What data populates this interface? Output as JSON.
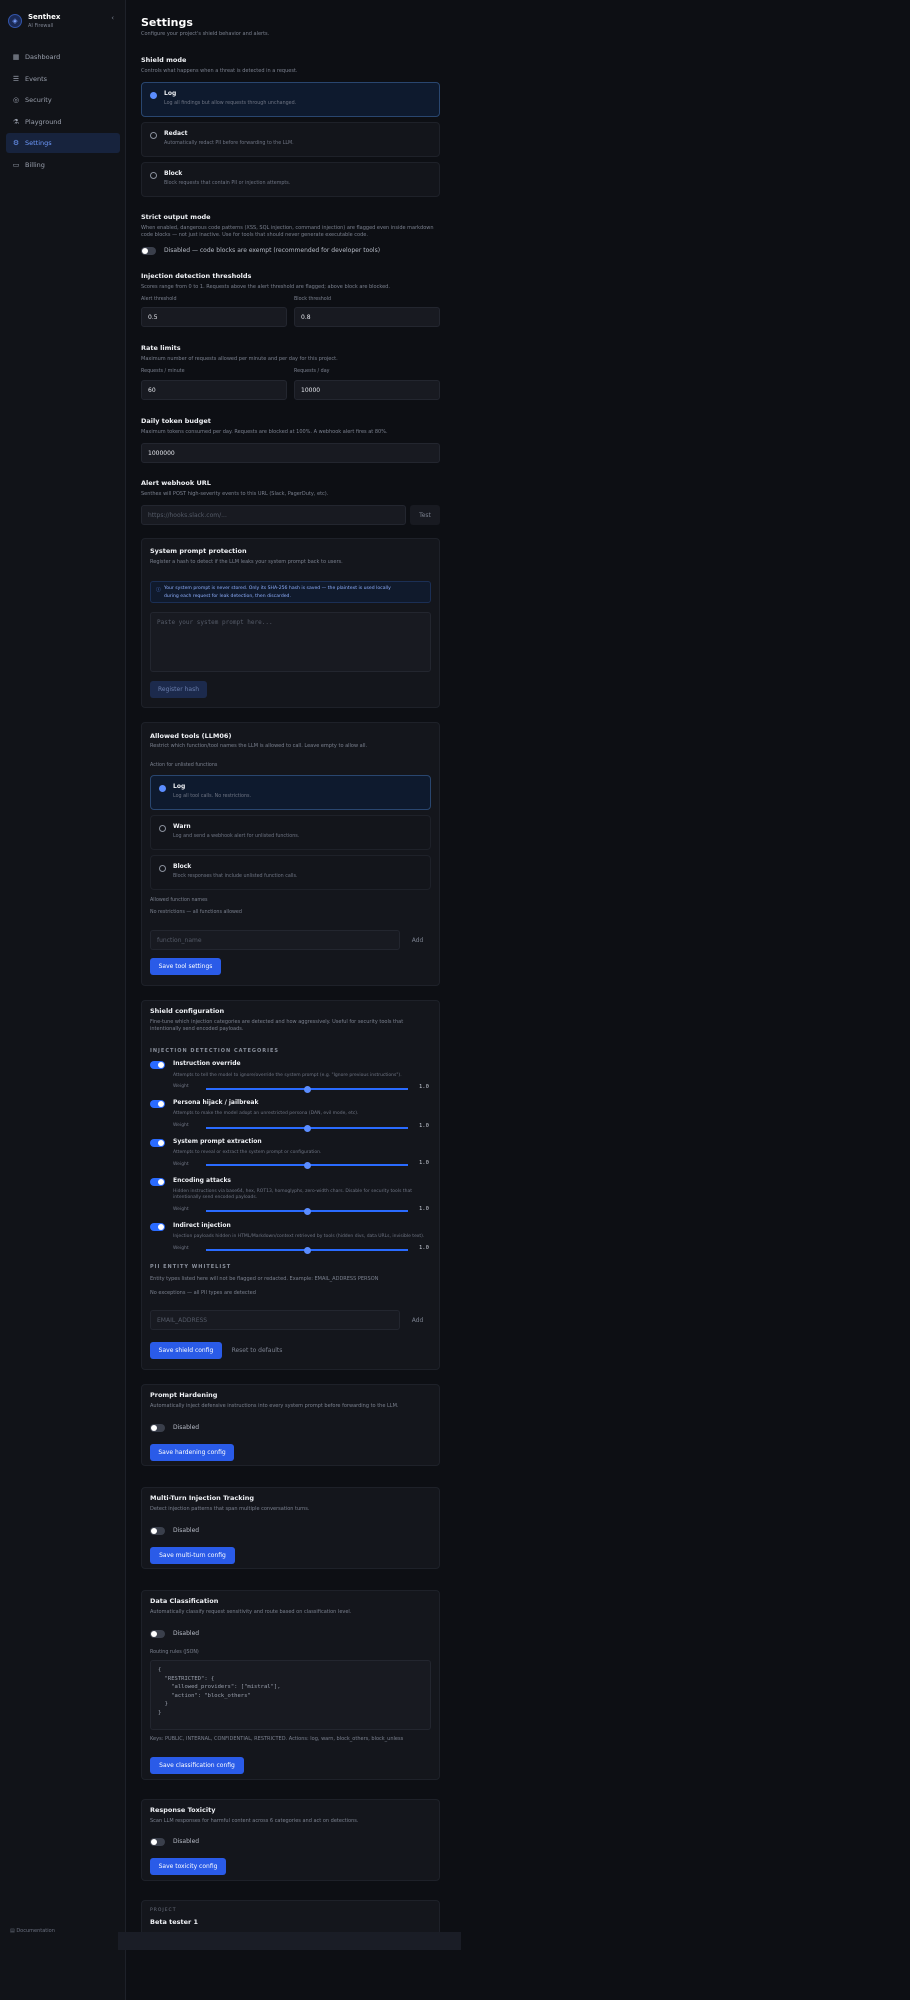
{
  "app": {
    "name": "Senthex",
    "subtitle": "AI Firewall",
    "collapse_icon": "chevron-left-icon"
  },
  "nav": [
    {
      "label": "Dashboard",
      "icon": "grid-icon",
      "active": false
    },
    {
      "label": "Events",
      "icon": "list-icon",
      "active": false
    },
    {
      "label": "Security",
      "icon": "shield-icon",
      "active": false
    },
    {
      "label": "Playground",
      "icon": "flask-icon",
      "active": false
    },
    {
      "label": "Settings",
      "icon": "gear-icon",
      "active": true
    },
    {
      "label": "Billing",
      "icon": "card-icon",
      "active": false
    }
  ],
  "footer": {
    "text": "Documentation"
  },
  "page": {
    "title": "Settings",
    "subtitle": "Configure your project's shield behavior and alerts."
  },
  "shield_mode": {
    "title": "Shield mode",
    "desc": "Controls what happens when a threat is detected in a request.",
    "options": [
      {
        "label": "Log",
        "desc": "Log all findings but allow requests through unchanged.",
        "selected": true
      },
      {
        "label": "Redact",
        "desc": "Automatically redact PII before forwarding to the LLM.",
        "selected": false
      },
      {
        "label": "Block",
        "desc": "Block requests that contain PII or injection attempts.",
        "selected": false
      }
    ]
  },
  "strict": {
    "title": "Strict output mode",
    "desc1": "When enabled, dangerous code patterns (XSS, SQL injection, command injection) are flagged even inside markdown code blocks — not just inactive. Use for tools that should never generate executable code.",
    "toggle_text": "Disabled — code blocks are exempt (recommended for developer tools)",
    "enabled": false
  },
  "thresholds": {
    "title": "Injection detection thresholds",
    "desc": "Scores range from 0 to 1. Requests above the alert threshold are flagged; above block are blocked.",
    "alert_label": "Alert threshold",
    "alert_value": "0.5",
    "block_label": "Block threshold",
    "block_value": "0.8"
  },
  "rate": {
    "title": "Rate limits",
    "desc": "Maximum number of requests allowed per minute and per day for this project.",
    "minute_label": "Requests / minute",
    "minute_value": "60",
    "day_label": "Requests / day",
    "day_value": "10000"
  },
  "budget": {
    "title": "Daily token budget",
    "desc": "Maximum tokens consumed per day. Requests are blocked at 100%. A webhook alert fires at 80%.",
    "value": "1000000"
  },
  "webhook": {
    "title": "Alert webhook URL",
    "desc": "Senthex will POST high-severity events to this URL (Slack, PagerDuty, etc).",
    "placeholder": "https://hooks.slack.com/...",
    "test_label": "Test"
  },
  "spp": {
    "title": "System prompt protection",
    "desc": "Register a hash to detect if the LLM leaks your system prompt back to users.",
    "info_a": "Your system prompt is never stored. Only its SHA-256 hash is saved — the plaintext is used locally",
    "info_b": "during each request for leak detection, then discarded.",
    "placeholder": "Paste your system prompt here...",
    "button": "Register hash"
  },
  "tools": {
    "title": "Allowed tools (LLM06)",
    "desc": "Restrict which function/tool names the LLM is allowed to call. Leave empty to allow all.",
    "action_label": "Action for unlisted functions",
    "options": [
      {
        "label": "Log",
        "desc": "Log all tool calls. No restrictions.",
        "selected": true
      },
      {
        "label": "Warn",
        "desc": "Log and send a webhook alert for unlisted functions.",
        "selected": false
      },
      {
        "label": "Block",
        "desc": "Block responses that include unlisted function calls.",
        "selected": false
      }
    ],
    "names_label": "Allowed function names",
    "names_hint": "No restrictions — all functions allowed",
    "placeholder": "function_name",
    "add": "Add",
    "save": "Save tool settings"
  },
  "shield_config": {
    "title": "Shield configuration",
    "desc": "Fine-tune which injection categories are detected and how aggressively. Useful for security tools that intentionally send encoded payloads.",
    "cat_header": "INJECTION DETECTION CATEGORIES",
    "weight_label": "Weight",
    "categories": [
      {
        "name": "Instruction override",
        "desc": "Attempts to tell the model to ignore/override the system prompt (e.g. \"Ignore previous instructions\").",
        "enabled": true,
        "weight": "1.0",
        "value": 0.5
      },
      {
        "name": "Persona hijack / jailbreak",
        "desc": "Attempts to make the model adopt an unrestricted persona (DAN, evil mode, etc).",
        "enabled": true,
        "weight": "1.0",
        "value": 0.5
      },
      {
        "name": "System prompt extraction",
        "desc": "Attempts to reveal or extract the system prompt or configuration.",
        "enabled": true,
        "weight": "1.0",
        "value": 0.5
      },
      {
        "name": "Encoding attacks",
        "desc": "Hidden instructions via base64, hex, ROT13, homoglyphs, zero-width chars. Disable for security tools that intentionally send encoded payloads.",
        "enabled": true,
        "weight": "1.0",
        "value": 0.5
      },
      {
        "name": "Indirect injection",
        "desc": "Injection payloads hidden in HTML/Markdown/context retrieved by tools (hidden divs, data URLs, invisible text).",
        "enabled": true,
        "weight": "1.0",
        "value": 0.5
      }
    ],
    "pii_header": "PII ENTITY WHITELIST",
    "pii_desc": "Entity types listed here will not be flagged or redacted. Example: EMAIL_ADDRESS PERSON",
    "pii_hint": "No exceptions — all PII types are detected",
    "pii_placeholder": "EMAIL_ADDRESS",
    "add": "Add",
    "save": "Save shield config",
    "reset": "Reset to defaults"
  },
  "hardening": {
    "title": "Prompt Hardening",
    "desc": "Automatically inject defensive instructions into every system prompt before forwarding to the LLM.",
    "toggle": "Disabled",
    "save": "Save hardening config"
  },
  "multiturn": {
    "title": "Multi-Turn Injection Tracking",
    "desc": "Detect injection patterns that span multiple conversation turns.",
    "toggle": "Disabled",
    "save": "Save multi-turn config"
  },
  "classification": {
    "title": "Data Classification",
    "desc": "Automatically classify request sensitivity and route based on classification level.",
    "toggle": "Disabled",
    "rules_label": "Routing rules (JSON)",
    "code": [
      "{",
      "  \"RESTRICTED\": {",
      "    \"allowed_providers\": [\"mistral\"],",
      "    \"action\": \"block_others\"",
      "  }",
      "}"
    ],
    "levels": "Keys: PUBLIC, INTERNAL, CONFIDENTIAL, RESTRICTED. Actions: log, warn, block_others, block_unless",
    "save": "Save classification config"
  },
  "toxicity": {
    "title": "Response Toxicity",
    "desc": "Scan LLM responses for harmful content across 6 categories and act on detections.",
    "toggle": "Disabled",
    "save": "Save toxicity config"
  },
  "project": {
    "label": "PROJECT",
    "name": "Beta tester 1"
  }
}
